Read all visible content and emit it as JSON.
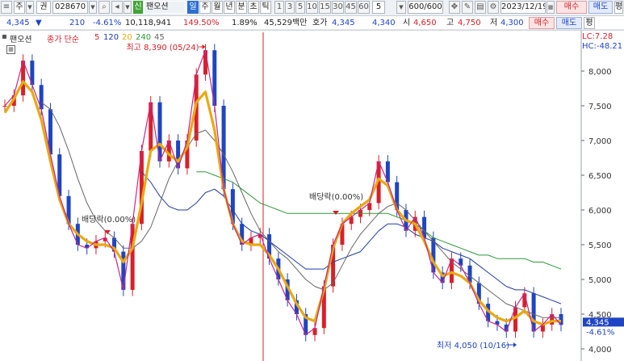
{
  "toolbar": {
    "market": "주",
    "code_type": "권",
    "code": "028670",
    "stock_badge": "신",
    "stock_name": "팬오션",
    "periods": [
      "일",
      "주",
      "월",
      "년",
      "분",
      "초",
      "틱"
    ],
    "minutes": [
      "1",
      "3",
      "5",
      "10",
      "15",
      "30",
      "45",
      "60"
    ],
    "interval": "5",
    "count": "600/600",
    "date": "2023/12/19",
    "buy": "매수",
    "sell": "매도",
    "eval": "평"
  },
  "quote": {
    "price": "4,345",
    "change": "210",
    "change_rate": "-4.61%",
    "volume": "10,118,941",
    "volume_ratio": "149.50%",
    "turnover": "1.89%",
    "amount": "45,529백만",
    "ask_label": "호가",
    "ask": "4,345",
    "bid": "4,340",
    "open_label": "시",
    "open": "4,650",
    "high_label": "고",
    "high": "4,750",
    "low_label": "저",
    "low": "4,300"
  },
  "legend": {
    "name": "팬오션",
    "ma_label": "종가 단순",
    "ma_periods": [
      "5",
      "120",
      "20",
      "240",
      "45"
    ],
    "colors": [
      "#d8202a",
      "#1f3ea8",
      "#e8a912",
      "#2e9a3a",
      "#666666"
    ]
  },
  "corner": {
    "lc": "LC:7.28",
    "hc": "HC:-48.21"
  },
  "annotations": {
    "high": "최고 8,390 (05/24)",
    "low": "최저 4,050 (10/16)",
    "dividend1": "배당락(0.00%)",
    "dividend2": "배당락(0.00%)"
  },
  "price_tag": {
    "price": "4,345",
    "rate": "-4.61%"
  },
  "chart_data": {
    "type": "line",
    "title": "",
    "ylim": [
      4000,
      8400
    ],
    "y_ticks": [
      4000,
      4500,
      5000,
      5500,
      6000,
      6500,
      7000,
      7500,
      8000
    ],
    "y_tick_labels": [
      "4,000",
      "4,500",
      "5,000",
      "5,500",
      "6,000",
      "6,500",
      "7,000",
      "7,500",
      "8,000"
    ],
    "high_point": {
      "value": 8390,
      "date": "05/24"
    },
    "low_point": {
      "value": 4050,
      "date": "10/16"
    },
    "last_price": 4345,
    "close": [
      7500,
      7650,
      8150,
      7800,
      7450,
      6800,
      6200,
      5800,
      5500,
      5450,
      5550,
      5600,
      5400,
      4850,
      5800,
      6850,
      7550,
      6700,
      7000,
      6600,
      7000,
      7950,
      8300,
      7500,
      6300,
      5800,
      5500,
      5600,
      5650,
      5300,
      5000,
      4700,
      4500,
      4200,
      4300,
      4900,
      5500,
      5800,
      5900,
      6000,
      6100,
      6700,
      6400,
      6000,
      5700,
      5900,
      5600,
      5100,
      4950,
      5300,
      5200,
      4950,
      4650,
      4400,
      4350,
      4250,
      4600,
      4800,
      4250,
      4350,
      4500,
      4345
    ],
    "series": [
      {
        "name": "5",
        "values": [
          7500,
          7650,
          8150,
          7800,
          7450,
          6800,
          6200,
          5800,
          5500,
          5450,
          5550,
          5600,
          5400,
          4850,
          5800,
          6850,
          7550,
          6700,
          7000,
          6600,
          7000,
          7950,
          8300,
          7500,
          6300,
          5800,
          5500,
          5600,
          5650,
          5300,
          5000,
          4700,
          4500,
          4200,
          4300,
          4900,
          5500,
          5800,
          5900,
          6000,
          6100,
          6700,
          6400,
          6000,
          5700,
          5900,
          5600,
          5100,
          4950,
          5300,
          5200,
          4950,
          4650,
          4400,
          4350,
          4250,
          4600,
          4800,
          4250,
          4350,
          4500,
          4345
        ]
      },
      {
        "name": "20",
        "values": [
          7400,
          7600,
          7850,
          7700,
          7300,
          6700,
          6150,
          5800,
          5650,
          5550,
          5500,
          5500,
          5450,
          5250,
          5450,
          6100,
          6850,
          6950,
          6800,
          6700,
          6900,
          7550,
          7700,
          7150,
          6300,
          5800,
          5550,
          5500,
          5500,
          5350,
          5150,
          4900,
          4650,
          4450,
          4400,
          4850,
          5450,
          5800,
          5950,
          6050,
          6150,
          6450,
          6350,
          6000,
          5850,
          5800,
          5550,
          5250,
          5050,
          5100,
          5050,
          4950,
          4700,
          4550,
          4450,
          4400,
          4450,
          4550,
          4400,
          4350,
          4400,
          4400
        ]
      },
      {
        "name": "45",
        "values": [
          null,
          null,
          null,
          null,
          7550,
          7450,
          7200,
          6850,
          6450,
          6100,
          5850,
          5700,
          5600,
          5450,
          5450,
          5550,
          5750,
          6100,
          6450,
          6700,
          6900,
          7100,
          7150,
          7000,
          6800,
          6550,
          6250,
          5950,
          5700,
          5550,
          5400,
          5300,
          5150,
          5000,
          4900,
          4850,
          4950,
          5200,
          5450,
          5650,
          5800,
          5950,
          6050,
          6100,
          6000,
          5850,
          5700,
          5550,
          5400,
          5250,
          5150,
          5050,
          4950,
          4850,
          4750,
          4650,
          4600,
          4550,
          4500,
          4450,
          4450,
          4450
        ]
      },
      {
        "name": "120",
        "values": [
          null,
          null,
          null,
          null,
          null,
          null,
          null,
          null,
          null,
          null,
          null,
          null,
          null,
          null,
          null,
          6550,
          6400,
          6200,
          6050,
          6000,
          6000,
          6100,
          6250,
          6300,
          6200,
          6000,
          5800,
          5700,
          5650,
          5550,
          5450,
          5350,
          5250,
          5150,
          5150,
          5150,
          5250,
          5300,
          5350,
          5400,
          5550,
          5700,
          5800,
          5800,
          5750,
          5650,
          5600,
          5550,
          5450,
          5400,
          5350,
          5300,
          5200,
          5100,
          5000,
          4900,
          4850,
          4850,
          4800,
          4750,
          4700,
          4650
        ]
      },
      {
        "name": "240",
        "values": [
          null,
          null,
          null,
          null,
          null,
          null,
          null,
          null,
          null,
          null,
          null,
          null,
          null,
          null,
          null,
          null,
          null,
          null,
          null,
          null,
          null,
          6550,
          6550,
          6500,
          6450,
          6400,
          6300,
          6200,
          6100,
          6050,
          6000,
          5950,
          5950,
          5950,
          5950,
          5950,
          5950,
          5950,
          5950,
          5950,
          5950,
          5950,
          5950,
          5900,
          5850,
          5800,
          5700,
          5600,
          5550,
          5500,
          5450,
          5400,
          5350,
          5350,
          5300,
          5300,
          5300,
          5300,
          5250,
          5250,
          5200,
          5150
        ]
      }
    ]
  }
}
